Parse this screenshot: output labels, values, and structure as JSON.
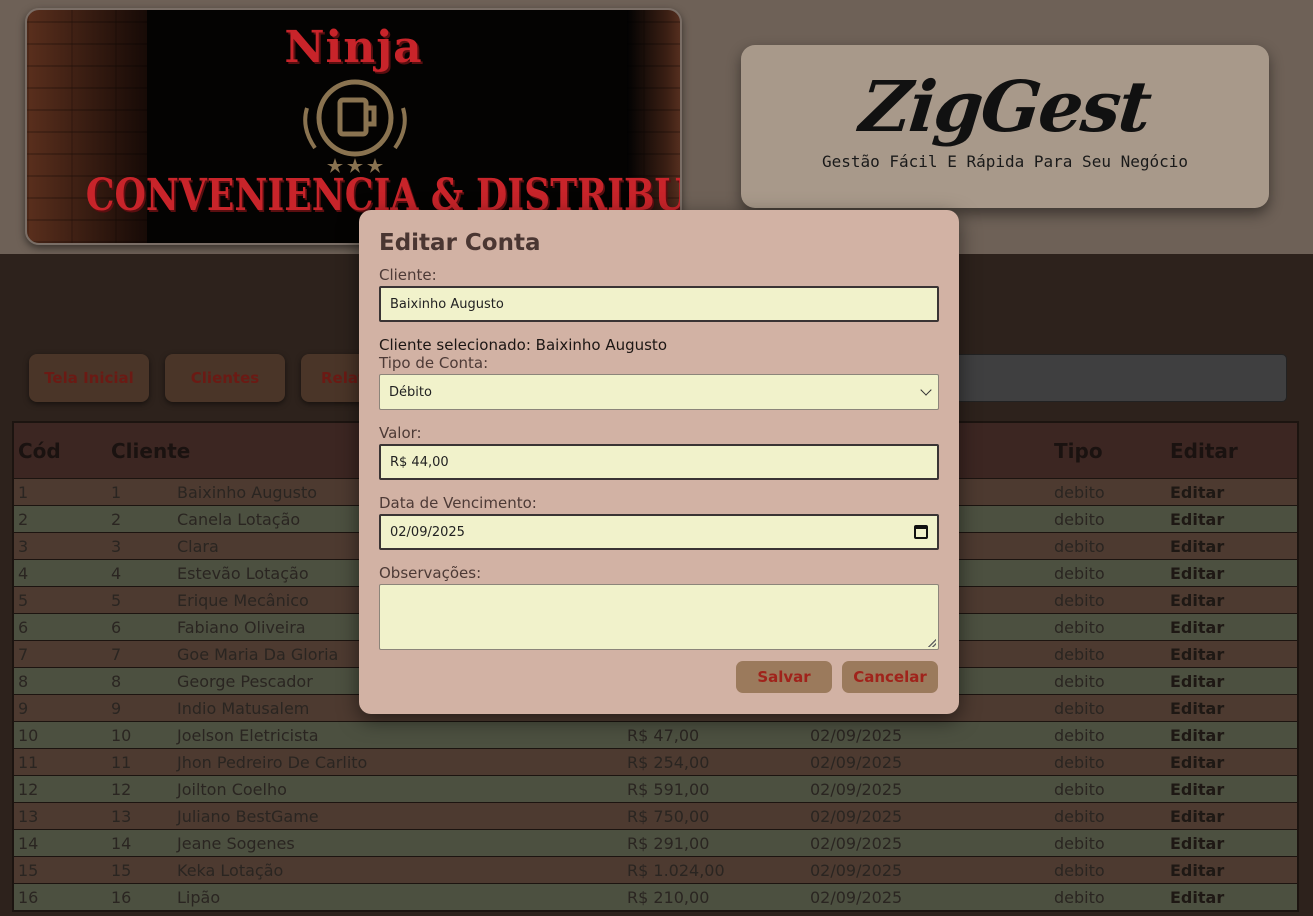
{
  "header": {
    "logo": {
      "line1": "Ninja",
      "line2": "CONVENIENCIA & DISTRIBUIDORA"
    },
    "brand": {
      "title": "ZigGest",
      "subtitle": "Gestão Fácil E Rápida Para Seu Negócio"
    }
  },
  "nav": {
    "items": [
      {
        "label": "Tela Inicial"
      },
      {
        "label": "Clientes"
      },
      {
        "label": "Relat"
      }
    ]
  },
  "table": {
    "headers": {
      "cod": "Cód",
      "cliente": "Cliente",
      "tipo": "Tipo",
      "editar": "Editar"
    },
    "rows": [
      {
        "cod": "1",
        "id": "1",
        "name": "Baixinho Augusto",
        "value": "",
        "date": "",
        "tipo": "debito",
        "edit": "Editar"
      },
      {
        "cod": "2",
        "id": "2",
        "name": "Canela Lotação",
        "value": "",
        "date": "",
        "tipo": "debito",
        "edit": "Editar"
      },
      {
        "cod": "3",
        "id": "3",
        "name": "Clara",
        "value": "",
        "date": "",
        "tipo": "debito",
        "edit": "Editar"
      },
      {
        "cod": "4",
        "id": "4",
        "name": "Estevão Lotação",
        "value": "",
        "date": "",
        "tipo": "debito",
        "edit": "Editar"
      },
      {
        "cod": "5",
        "id": "5",
        "name": "Erique Mecânico",
        "value": "",
        "date": "",
        "tipo": "debito",
        "edit": "Editar"
      },
      {
        "cod": "6",
        "id": "6",
        "name": "Fabiano Oliveira",
        "value": "",
        "date": "",
        "tipo": "debito",
        "edit": "Editar"
      },
      {
        "cod": "7",
        "id": "7",
        "name": "Goe Maria Da Gloria",
        "value": "",
        "date": "",
        "tipo": "debito",
        "edit": "Editar"
      },
      {
        "cod": "8",
        "id": "8",
        "name": "George Pescador",
        "value": "",
        "date": "",
        "tipo": "debito",
        "edit": "Editar"
      },
      {
        "cod": "9",
        "id": "9",
        "name": "Indio Matusalem",
        "value": "",
        "date": "",
        "tipo": "debito",
        "edit": "Editar"
      },
      {
        "cod": "10",
        "id": "10",
        "name": "Joelson Eletricista",
        "value": "R$ 47,00",
        "date": "02/09/2025",
        "tipo": "debito",
        "edit": "Editar"
      },
      {
        "cod": "11",
        "id": "11",
        "name": "Jhon Pedreiro De Carlito",
        "value": "R$ 254,00",
        "date": "02/09/2025",
        "tipo": "debito",
        "edit": "Editar"
      },
      {
        "cod": "12",
        "id": "12",
        "name": "Joilton Coelho",
        "value": "R$ 591,00",
        "date": "02/09/2025",
        "tipo": "debito",
        "edit": "Editar"
      },
      {
        "cod": "13",
        "id": "13",
        "name": "Juliano BestGame",
        "value": "R$ 750,00",
        "date": "02/09/2025",
        "tipo": "debito",
        "edit": "Editar"
      },
      {
        "cod": "14",
        "id": "14",
        "name": "Jeane Sogenes",
        "value": "R$ 291,00",
        "date": "02/09/2025",
        "tipo": "debito",
        "edit": "Editar"
      },
      {
        "cod": "15",
        "id": "15",
        "name": "Keka Lotação",
        "value": "R$ 1.024,00",
        "date": "02/09/2025",
        "tipo": "debito",
        "edit": "Editar"
      },
      {
        "cod": "16",
        "id": "16",
        "name": "Lipão",
        "value": "R$ 210,00",
        "date": "02/09/2025",
        "tipo": "debito",
        "edit": "Editar"
      }
    ]
  },
  "modal": {
    "title": "Editar Conta",
    "cliente_label": "Cliente:",
    "cliente_value": "Baixinho Augusto",
    "selected_text": "Cliente selecionado: Baixinho Augusto",
    "tipo_label": "Tipo de Conta:",
    "tipo_value": "Débito",
    "valor_label": "Valor:",
    "valor_value": "R$ 44,00",
    "data_label": "Data de Vencimento:",
    "data_value": "02/09/2025",
    "obs_label": "Observações:",
    "obs_value": "",
    "save_label": "Salvar",
    "cancel_label": "Cancelar"
  },
  "colors": {
    "accent": "#a0231b",
    "modal_bg": "#d2b2a4",
    "field_bg": "#f1f2cb"
  }
}
